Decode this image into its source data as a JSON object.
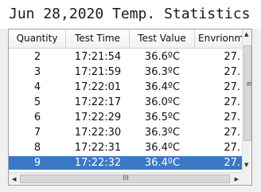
{
  "title": "Jun 28,2020 Temp. Statistics",
  "table": {
    "columns": [
      "Quantity",
      "Test Time",
      "Test Value",
      "Envrionme"
    ],
    "rows": [
      {
        "quantity": "2",
        "time": "17:21:54",
        "value": "36.6ºC",
        "env": "27."
      },
      {
        "quantity": "3",
        "time": "17:21:59",
        "value": "36.3ºC",
        "env": "27."
      },
      {
        "quantity": "4",
        "time": "17:22:01",
        "value": "36.4ºC",
        "env": "27."
      },
      {
        "quantity": "5",
        "time": "17:22:17",
        "value": "36.0ºC",
        "env": "27."
      },
      {
        "quantity": "6",
        "time": "17:22:29",
        "value": "36.5ºC",
        "env": "27."
      },
      {
        "quantity": "7",
        "time": "17:22:30",
        "value": "36.3ºC",
        "env": "27."
      },
      {
        "quantity": "8",
        "time": "17:22:31",
        "value": "36.4ºC",
        "env": "27."
      },
      {
        "quantity": "9",
        "time": "17:22:32",
        "value": "36.4ºC",
        "env": "27."
      }
    ],
    "selected_row_index": 7
  },
  "scrollbars": {
    "up_icon": "▲",
    "down_icon": "▼",
    "left_icon": "◀",
    "right_icon": "▶",
    "v_grip_icon": "≡",
    "h_grip_icon": "III"
  },
  "colors": {
    "selection": "#3b79c5"
  }
}
